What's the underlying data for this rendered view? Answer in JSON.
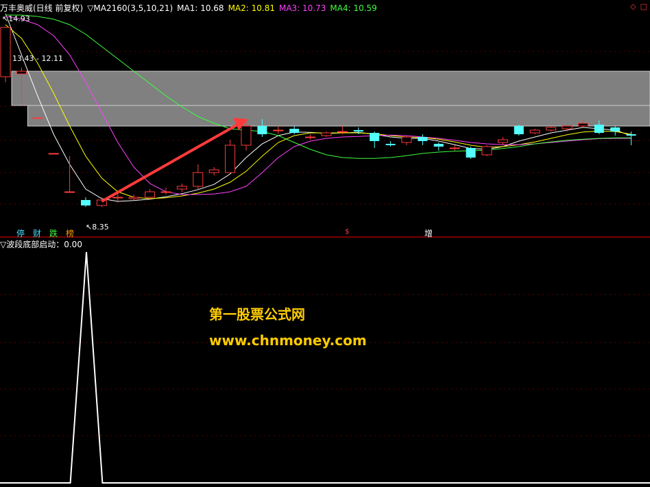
{
  "header": {
    "stock_name": "万丰奥威(日线 前复权)",
    "indicator": "▽MA2160(3,5,10,21)",
    "ma1": "MA1: 10.68",
    "ma2": "MA2: 10.81",
    "ma3": "MA3: 10.73",
    "ma4": "MA4: 10.59",
    "colors": {
      "title": "#ffffff",
      "ma1": "#ffffff",
      "ma2": "#ffff00",
      "ma3": "#ff40ff",
      "ma4": "#40ff40"
    }
  },
  "top_icons": [
    "◇",
    "□"
  ],
  "labels": {
    "high": "14.93",
    "range": "13.43 - 12.11",
    "low": "8.35"
  },
  "event_tags": [
    {
      "text": "停",
      "color": "#40e0ff"
    },
    {
      "text": "财",
      "color": "#40e0ff"
    },
    {
      "text": "跌",
      "color": "#40ff40"
    },
    {
      "text": "榜",
      "color": "#ff9900"
    },
    {
      "text": "$",
      "color": "#ff3b3b"
    },
    {
      "text": "增",
      "color": "#ffffff"
    }
  ],
  "sub_panel": {
    "title": "▽波段底部启动：0.00"
  },
  "watermark": {
    "line1": "第一股票公式网",
    "line2": "www.chnmoney.com"
  },
  "chart_data": [
    {
      "type": "candlestick",
      "title": "万丰奥威(日线 前复权)",
      "ylim": [
        8.0,
        15.2
      ],
      "series": [
        {
          "name": "MA1",
          "color": "#ffffff"
        },
        {
          "name": "MA2",
          "color": "#ffff00"
        },
        {
          "name": "MA3",
          "color": "#ff40ff"
        },
        {
          "name": "MA4",
          "color": "#40ff40"
        }
      ],
      "candles": [
        {
          "o": 13.1,
          "c": 14.9,
          "h": 14.93,
          "l": 12.9
        },
        {
          "o": 13.2,
          "c": 13.3,
          "h": 13.43,
          "l": 12.11
        },
        {
          "o": 11.6,
          "c": 11.6,
          "h": 11.6,
          "l": 11.6
        },
        {
          "o": 10.3,
          "c": 10.3,
          "h": 10.3,
          "l": 10.3
        },
        {
          "o": 8.9,
          "c": 8.9,
          "h": 10.2,
          "l": 8.9
        },
        {
          "o": 8.6,
          "c": 8.4,
          "h": 8.7,
          "l": 8.35
        },
        {
          "o": 8.4,
          "c": 8.6,
          "h": 8.7,
          "l": 8.35
        },
        {
          "o": 8.7,
          "c": 8.7,
          "h": 8.9,
          "l": 8.5
        },
        {
          "o": 8.65,
          "c": 8.7,
          "h": 8.8,
          "l": 8.6
        },
        {
          "o": 8.7,
          "c": 8.9,
          "h": 9.0,
          "l": 8.6
        },
        {
          "o": 8.9,
          "c": 8.9,
          "h": 9.05,
          "l": 8.8
        },
        {
          "o": 9.0,
          "c": 9.1,
          "h": 9.2,
          "l": 8.9
        },
        {
          "o": 9.1,
          "c": 9.6,
          "h": 9.9,
          "l": 9.0
        },
        {
          "o": 9.6,
          "c": 9.7,
          "h": 9.8,
          "l": 9.5
        },
        {
          "o": 9.6,
          "c": 10.6,
          "h": 10.8,
          "l": 9.6
        },
        {
          "o": 10.6,
          "c": 11.3,
          "h": 11.5,
          "l": 10.4
        },
        {
          "o": 11.3,
          "c": 11.0,
          "h": 11.55,
          "l": 10.9
        },
        {
          "o": 11.15,
          "c": 11.15,
          "h": 11.3,
          "l": 11.0
        },
        {
          "o": 11.2,
          "c": 11.05,
          "h": 11.3,
          "l": 11.0
        },
        {
          "o": 10.9,
          "c": 10.9,
          "h": 11.0,
          "l": 10.8
        },
        {
          "o": 10.95,
          "c": 11.05,
          "h": 11.1,
          "l": 10.9
        },
        {
          "o": 11.1,
          "c": 11.1,
          "h": 11.3,
          "l": 11.0
        },
        {
          "o": 11.15,
          "c": 11.1,
          "h": 11.25,
          "l": 11.0
        },
        {
          "o": 11.05,
          "c": 10.75,
          "h": 11.1,
          "l": 10.5
        },
        {
          "o": 10.65,
          "c": 10.6,
          "h": 10.75,
          "l": 10.55
        },
        {
          "o": 10.7,
          "c": 10.9,
          "h": 10.95,
          "l": 10.6
        },
        {
          "o": 10.9,
          "c": 10.75,
          "h": 11.0,
          "l": 10.6
        },
        {
          "o": 10.65,
          "c": 10.55,
          "h": 10.7,
          "l": 10.4
        },
        {
          "o": 10.5,
          "c": 10.5,
          "h": 10.6,
          "l": 10.4
        },
        {
          "o": 10.5,
          "c": 10.15,
          "h": 10.55,
          "l": 10.1
        },
        {
          "o": 10.25,
          "c": 10.55,
          "h": 10.6,
          "l": 10.2
        },
        {
          "o": 10.7,
          "c": 10.8,
          "h": 10.9,
          "l": 10.6
        },
        {
          "o": 11.3,
          "c": 11.0,
          "h": 11.35,
          "l": 10.95
        },
        {
          "o": 11.05,
          "c": 11.15,
          "h": 11.2,
          "l": 11.0
        },
        {
          "o": 11.15,
          "c": 11.25,
          "h": 11.3,
          "l": 11.1
        },
        {
          "o": 11.2,
          "c": 11.3,
          "h": 11.35,
          "l": 11.1
        },
        {
          "o": 11.3,
          "c": 11.4,
          "h": 11.55,
          "l": 11.25
        },
        {
          "o": 11.35,
          "c": 11.05,
          "h": 11.5,
          "l": 11.0
        },
        {
          "o": 11.25,
          "c": 11.1,
          "h": 11.3,
          "l": 10.95
        },
        {
          "o": 11.0,
          "c": 10.95,
          "h": 11.1,
          "l": 10.6
        }
      ],
      "ma1": [
        15.4,
        13.9,
        12.4,
        11.0,
        9.9,
        9.0,
        8.65,
        8.55,
        8.58,
        8.63,
        8.72,
        8.83,
        8.98,
        9.17,
        9.55,
        10.15,
        10.65,
        10.95,
        11.08,
        11.07,
        11.03,
        11.05,
        11.07,
        11.0,
        10.9,
        10.85,
        10.85,
        10.75,
        10.62,
        10.48,
        10.45,
        10.55,
        10.75,
        10.9,
        11.05,
        11.15,
        11.25,
        11.2,
        11.15,
        10.95
      ],
      "ma2": [
        15.0,
        14.5,
        13.6,
        12.5,
        11.3,
        10.2,
        9.4,
        8.9,
        8.7,
        8.65,
        8.68,
        8.75,
        8.85,
        9.0,
        9.25,
        9.65,
        10.2,
        10.7,
        10.95,
        11.05,
        11.05,
        11.05,
        11.05,
        11.02,
        10.95,
        10.9,
        10.88,
        10.82,
        10.72,
        10.6,
        10.52,
        10.55,
        10.62,
        10.72,
        10.85,
        10.98,
        11.08,
        11.12,
        11.1,
        11.0
      ],
      "ma3": [
        15.3,
        15.2,
        15.0,
        14.6,
        13.9,
        12.9,
        11.8,
        10.7,
        9.8,
        9.2,
        8.9,
        8.8,
        8.8,
        8.82,
        8.9,
        9.1,
        9.6,
        10.15,
        10.55,
        10.75,
        10.85,
        10.9,
        10.92,
        10.95,
        10.97,
        10.95,
        10.9,
        10.85,
        10.78,
        10.7,
        10.65,
        10.62,
        10.62,
        10.65,
        10.7,
        10.75,
        10.8,
        10.84,
        10.85,
        10.85
      ],
      "ma4": [
        15.35,
        15.35,
        15.3,
        15.2,
        15.0,
        14.65,
        14.2,
        13.75,
        13.3,
        12.85,
        12.4,
        12.0,
        11.65,
        11.4,
        11.2,
        11.15,
        11.1,
        10.95,
        10.7,
        10.45,
        10.25,
        10.15,
        10.12,
        10.12,
        10.15,
        10.22,
        10.3,
        10.35,
        10.38,
        10.4,
        10.42,
        10.48,
        10.55,
        10.65,
        10.72,
        10.78,
        10.82,
        10.85,
        10.87,
        10.87
      ],
      "resistance_zones": [
        {
          "top": 13.3,
          "bottom": 12.05
        },
        {
          "top": 12.05,
          "bottom": 11.3
        }
      ]
    },
    {
      "type": "line",
      "title": "波段底部启动",
      "ylim": [
        0,
        1
      ],
      "x": [
        1,
        2,
        3,
        4,
        5,
        6,
        7,
        8,
        9,
        10,
        11,
        12,
        13,
        14,
        15,
        16,
        17,
        18,
        19,
        20,
        21,
        22,
        23,
        24,
        25,
        26,
        27,
        28,
        29,
        30,
        31,
        32,
        33,
        34,
        35,
        36,
        37,
        38,
        39,
        40
      ],
      "values": [
        0,
        0,
        0,
        0,
        0,
        1,
        0,
        0,
        0,
        0,
        0,
        0,
        0,
        0,
        0,
        0,
        0,
        0,
        0,
        0,
        0,
        0,
        0,
        0,
        0,
        0,
        0,
        0,
        0,
        0,
        0,
        0,
        0,
        0,
        0,
        0,
        0,
        0,
        0,
        0
      ]
    }
  ]
}
